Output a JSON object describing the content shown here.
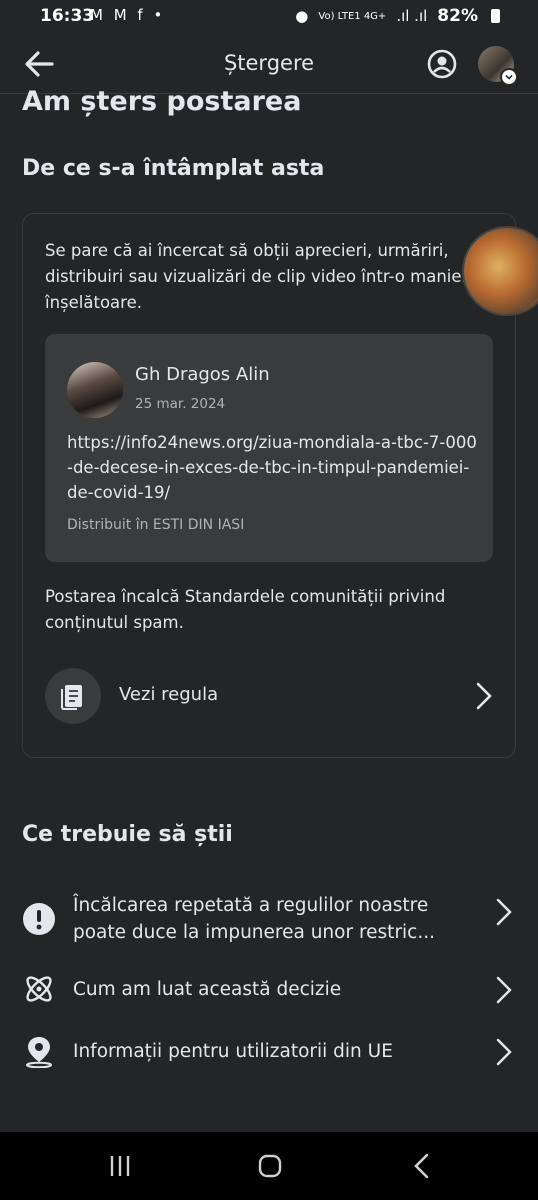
{
  "status_bar": {
    "time": "16:33",
    "notifications": "M M f •",
    "network": "Vo) LTE1 4G+",
    "battery": "82%"
  },
  "header": {
    "title": "Ștergere",
    "back_icon": "arrow-left-icon",
    "profile_icon": "account-circle-icon"
  },
  "heading_cut": "Am șters postarea",
  "why_section": {
    "title": "De ce s-a întâmplat asta",
    "description": "Se pare că ai încercat să obții aprecieri, urmăriri, distribuiri sau vizualizări de clip video într-o manieră înșelătoare.",
    "post": {
      "author": "Gh Dragos Alin",
      "date": "25 mar. 2024",
      "link": "https://info24news.org/ziua-mondiala-a-tbc-7-000-de-decese-in-exces-de-tbc-in-timpul-pandemiei-de-covid-19/",
      "shared_in": "Distribuit în ESTI DIN IASI"
    },
    "violation": "Postarea încalcă Standardele comunității privind conținutul spam.",
    "rule_link": "Vezi regula"
  },
  "know_section": {
    "title": "Ce trebuie să știi",
    "items": [
      {
        "label": "Încălcarea repetată a regulilor noastre poate duce la impunerea unor restric...",
        "icon": "exclamation-circle-icon"
      },
      {
        "label": "Cum am luat această decizie",
        "icon": "atom-icon"
      },
      {
        "label": "Informații pentru utilizatorii din UE",
        "icon": "location-pin-icon"
      }
    ]
  }
}
